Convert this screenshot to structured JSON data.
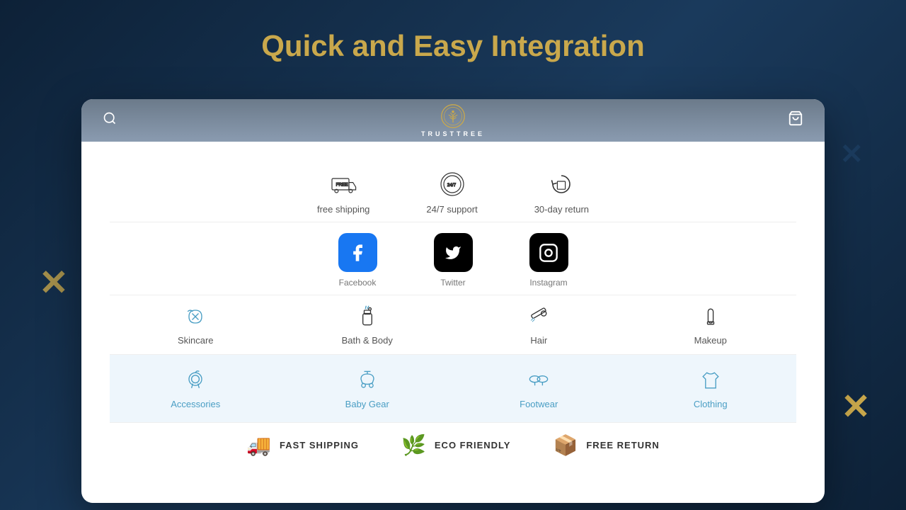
{
  "page": {
    "title_part1": "Quick and",
    "title_part2": "Easy Integration"
  },
  "nav": {
    "logo_text": "TRUSTTREE",
    "search_aria": "search",
    "cart_aria": "cart"
  },
  "features": [
    {
      "id": "free-shipping",
      "label": "free shipping",
      "icon": "shipping"
    },
    {
      "id": "support247",
      "label": "24/7 support",
      "icon": "support"
    },
    {
      "id": "return30",
      "label": "30-day return",
      "icon": "return"
    }
  ],
  "socials": [
    {
      "id": "facebook",
      "label": "Facebook",
      "type": "fb"
    },
    {
      "id": "twitter",
      "label": "Twitter",
      "type": "tw"
    },
    {
      "id": "instagram",
      "label": "Instagram",
      "type": "ig"
    }
  ],
  "categories_row1": [
    {
      "id": "skincare",
      "label": "Skincare",
      "icon": "tag"
    },
    {
      "id": "bath-body",
      "label": "Bath & Body",
      "icon": "bottle"
    },
    {
      "id": "hair",
      "label": "Hair",
      "icon": "brush"
    },
    {
      "id": "makeup",
      "label": "Makeup",
      "icon": "lipstick"
    }
  ],
  "categories_row2": [
    {
      "id": "accessories",
      "label": "Accessories",
      "icon": "accessories"
    },
    {
      "id": "baby-gear",
      "label": "Baby Gear",
      "icon": "stroller"
    },
    {
      "id": "footwear",
      "label": "Footwear",
      "icon": "glasses"
    },
    {
      "id": "clothing",
      "label": "Clothing",
      "icon": "tshirt"
    }
  ],
  "bottom_features": [
    {
      "id": "fast-shipping",
      "label": "FAST SHIPPING",
      "icon": "truck"
    },
    {
      "id": "eco-friendly",
      "label": "ECO FRIENDLY",
      "icon": "leaf"
    },
    {
      "id": "free-return",
      "label": "FREE RETURN",
      "icon": "box-return"
    }
  ]
}
